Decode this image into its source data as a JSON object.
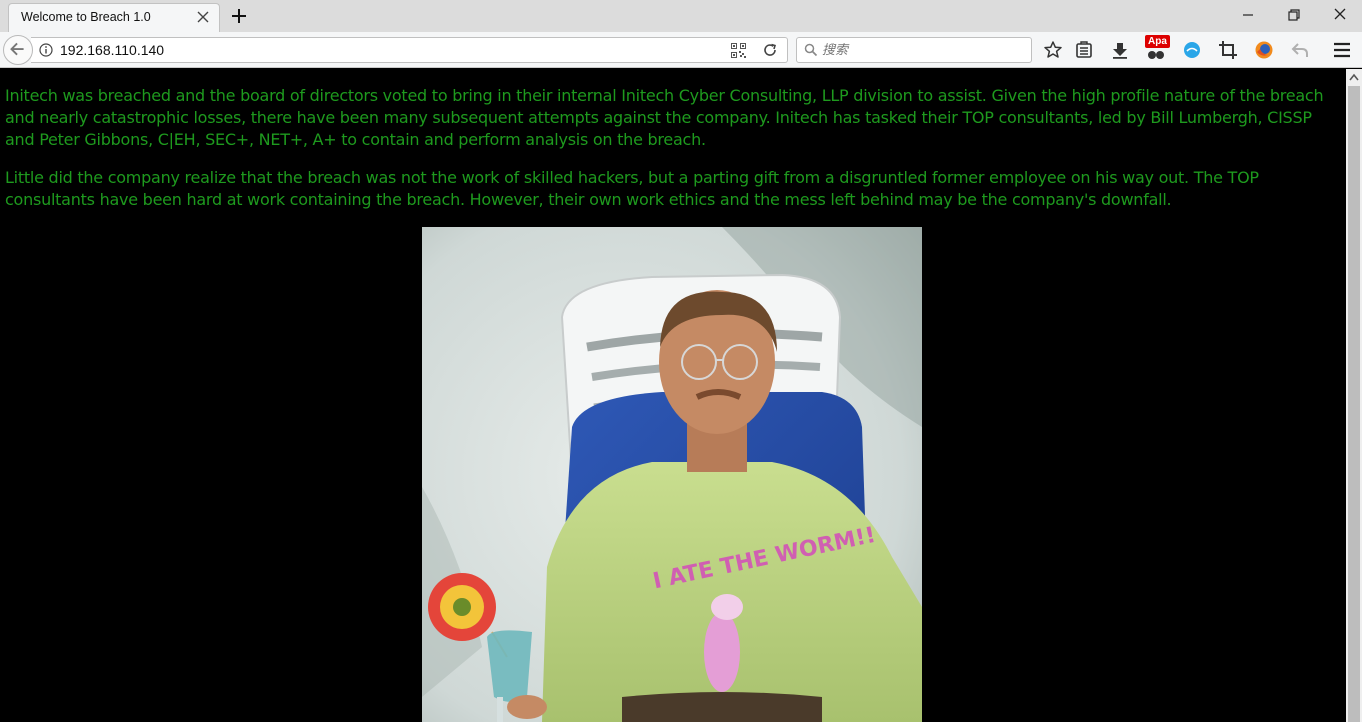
{
  "tab": {
    "title": "Welcome to Breach 1.0"
  },
  "navbar": {
    "url": "192.168.110.140",
    "search_placeholder": "搜索"
  },
  "toolbar": {
    "apa_badge": "Apa"
  },
  "page": {
    "paragraphs": [
      "Initech was breached and the board of directors voted to bring in their internal Initech Cyber Consulting, LLP division to assist. Given the high profile nature of the breach and nearly catastrophic losses, there have been many subsequent attempts against the company. Initech has tasked their TOP consultants, led by Bill Lumbergh, CISSP and Peter Gibbons, C|EH, SEC+, NET+, A+ to contain and perform analysis on the breach.",
      "Little did the company realize that the breach was not the work of skilled hackers, but a parting gift from a disgruntled former employee on his way out. The TOP consultants have been hard at work containing the breach. However, their own work ethics and the mess left behind may be the company's downfall."
    ],
    "photo_shirt_text": "I ATE THE WORM!!",
    "text_color": "#1e9a1e",
    "background_color": "#000000"
  }
}
